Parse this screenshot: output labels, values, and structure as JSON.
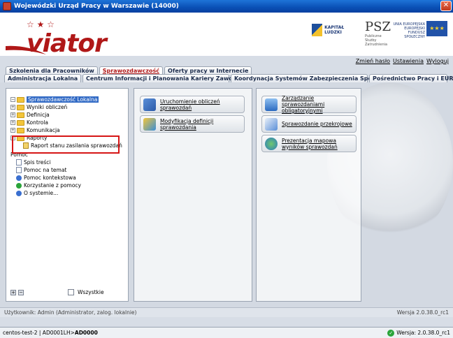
{
  "window": {
    "title": "Wojewódzki Urząd Pracy w Warszawie (14000)"
  },
  "banner": {
    "logo_text": "viator",
    "kl_label": "KAPITAŁ LUDZKI",
    "psz_title": "PSZ",
    "psz_sub": "Publiczne Służby Zatrudnienia",
    "ue_text": "UNIA EUROPEJSKA EUROPEJSKI FUNDUSZ SPOŁECZNY"
  },
  "toplinks": [
    "Zmień hasło",
    "Ustawienia",
    "Wyloguj"
  ],
  "tabs_row1": [
    {
      "label": "Szkolenia dla Pracowników",
      "active": false
    },
    {
      "label": "Sprawozdawczość",
      "active": true
    },
    {
      "label": "Oferty pracy w Internecie",
      "active": false
    }
  ],
  "tabs_row2": [
    "Administracja Lokalna",
    "Centrum Informacji i Planowania Kariery Zawodowej",
    "Koordynacja Systemów Zabezpieczenia Społecznego",
    "Pośrednictwo Pracy i EURES"
  ],
  "tree": {
    "root": "Sprawozdawczość Lokalna",
    "folders": [
      "Wyniki obliczeń",
      "Definicja",
      "Kontrola",
      "Komunikacja"
    ],
    "raporty": "Raporty",
    "raporty_child": "Raport stanu zasilania sprawozdań",
    "pomoc": "Pomoc",
    "pomoc_items": [
      "Spis treści",
      "Pomoc na temat",
      "Pomoc kontekstowa",
      "Korzystanie z pomocy",
      "O systemie..."
    ],
    "wszystkie": "Wszystkie"
  },
  "actions_mid": [
    "Uruchomienie obliczeń sprawozdań",
    "Modyfikacja definicji sprawozdania"
  ],
  "actions_right": [
    "Zarządzanie sprawozdaniami obligatoryjnymi",
    "Sprawozdanie przekrojowe",
    "Prezentacja mapowa wyników sprawozdań"
  ],
  "status": {
    "user": "Użytkownik: Admin (Administrator, zalog. lokalnie)",
    "version": "Wersja 2.0.38.0_rc1",
    "host": "centos-test-2 | AD0001LH>",
    "host_bold": "AD0000",
    "version2": "Wersja: 2.0.38.0_rc1"
  }
}
